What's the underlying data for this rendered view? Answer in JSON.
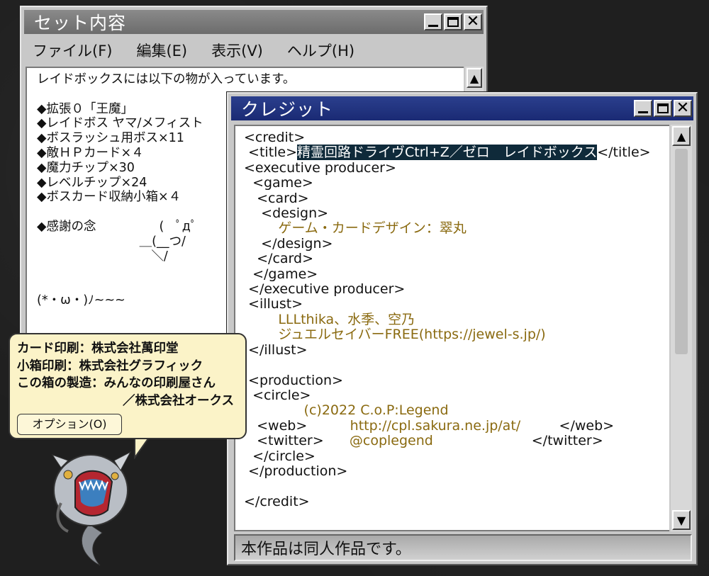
{
  "window1": {
    "title": "セット内容",
    "menu": [
      "ファイル(F)",
      "編集(E)",
      "表示(V)",
      "ヘルプ(H)"
    ],
    "lines": [
      "レイドボックスには以下の物が入っています。",
      "",
      "◆拡張０「王魔」",
      "◆レイドボス ヤマ/メフィスト",
      "◆ボスラッシュ用ボス×11",
      "◆敵ＨＰカード×４",
      "◆魔力チップ×30",
      "◆レベルチップ×24",
      "◆ボスカード収納小箱×４",
      "",
      "◆感謝の念                (   ﾟдﾟ",
      "                          ＿(__つ/",
      "                             ＼/",
      "",
      "",
      "(*・ω・)ﾉ~~~"
    ]
  },
  "window2": {
    "title": "クレジット",
    "lines": [
      {
        "t": "<credit>"
      },
      {
        "pre": " <title>",
        "hl": "精霊回路ドライヴCtrl+Z／ゼロ　レイドボックス",
        "post": "</title>"
      },
      {
        "t": "<executive producer>"
      },
      {
        "t": "  <game>"
      },
      {
        "t": "   <card>"
      },
      {
        "t": "    <design>"
      },
      {
        "g": "        ゲーム・カードデザイン：翠丸"
      },
      {
        "t": "    </design>"
      },
      {
        "t": "   </card>"
      },
      {
        "t": "  </game>"
      },
      {
        "t": " </executive producer>"
      },
      {
        "t": " <illust>"
      },
      {
        "g": "        LLLthika、水季、空乃"
      },
      {
        "g": "        ジュエルセイバーFREE(https://jewel-s.jp/)"
      },
      {
        "t": " </illust>"
      },
      {
        "t": ""
      },
      {
        "t": " <production>"
      },
      {
        "t": "  <circle>"
      },
      {
        "g": "              (c)2022 C.o.P:Legend"
      },
      {
        "pre": "   <web>",
        "g2": "          http://cpl.sakura.ne.jp/at/",
        "post": "         </web>"
      },
      {
        "pre": "   <twitter>",
        "g2": "      @coplegend",
        "post": "                       </twitter>"
      },
      {
        "t": "  </circle>"
      },
      {
        "t": " </production>"
      },
      {
        "t": ""
      },
      {
        "t": "</credit>"
      }
    ],
    "status": "本作品は同人作品です。"
  },
  "bubble": {
    "line1": "カード印刷：株式会社萬印堂",
    "line2": "小箱印刷：株式会社グラフィック",
    "line3": "この箱の製造：みんなの印刷屋さん",
    "line4": "／株式会社オークス",
    "option": "オプション(O)"
  },
  "colors": {
    "accent_title": "#1a2a74",
    "highlight": "#0f2a3a",
    "credit_value": "#8a6a10",
    "bubble": "#fbf3c8"
  }
}
